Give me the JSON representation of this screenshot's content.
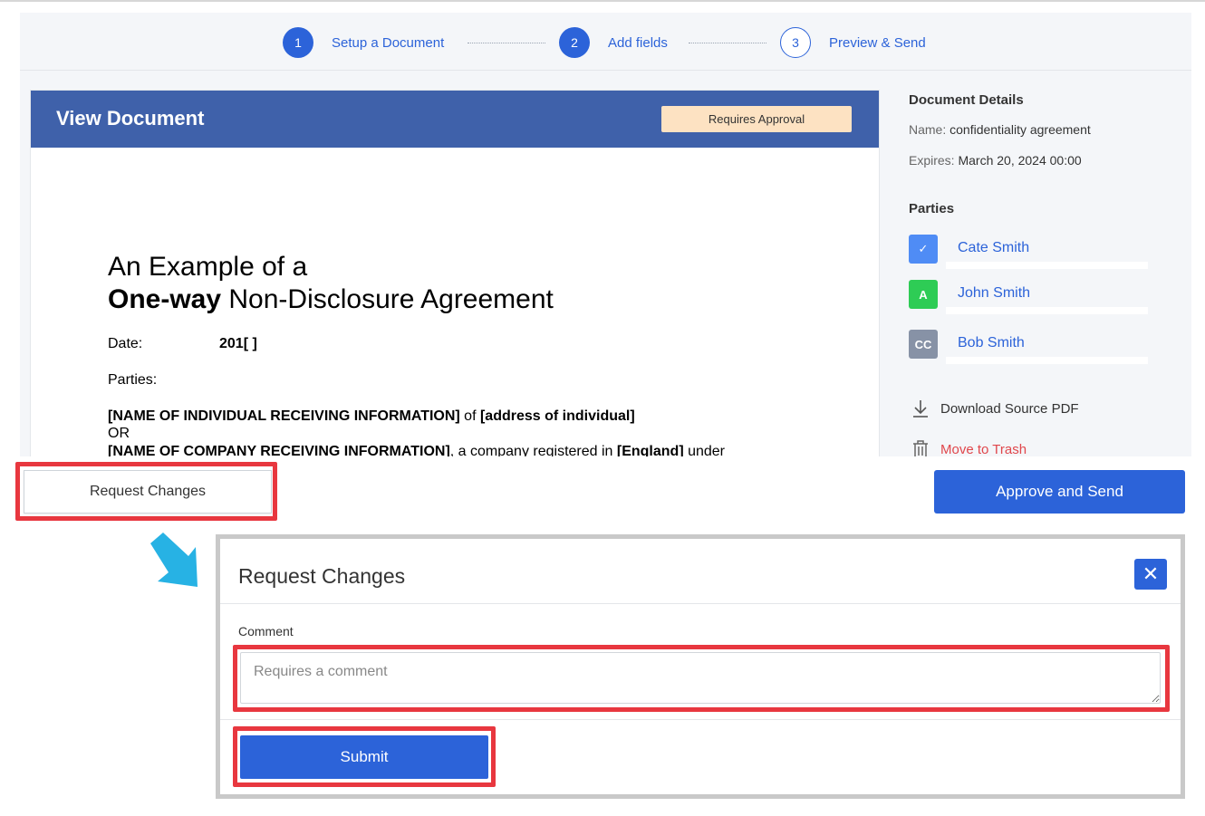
{
  "stepper": {
    "steps": [
      {
        "num": "1",
        "label": "Setup a Document"
      },
      {
        "num": "2",
        "label": "Add fields"
      },
      {
        "num": "3",
        "label": "Preview & Send"
      }
    ]
  },
  "viewer": {
    "title": "View Document",
    "badge": "Requires Approval"
  },
  "document": {
    "title_line1": "An Example of a",
    "title_line2_bold": "One-way",
    "title_line2_rest": " Non-Disclosure Agreement",
    "date_label": "Date:",
    "date_value": "201[ ]",
    "parties_label": "Parties:",
    "para1_bold": "[NAME OF INDIVIDUAL RECEIVING INFORMATION]",
    "para1_mid": " of ",
    "para1_bold2": "[address of individual]",
    "or": "OR",
    "para2_bold": "[NAME OF COMPANY RECEIVING INFORMATION]",
    "para2_mid": ", a company registered in ",
    "para2_bold2": "[England]",
    "para2_end": " under"
  },
  "sidebar": {
    "details_heading": "Document Details",
    "name_key": "Name:",
    "name_value": "confidentiality agreement",
    "expires_key": "Expires:",
    "expires_value": "March 20, 2024 00:00",
    "parties_heading": "Parties",
    "parties": [
      {
        "avatar": "✓",
        "name": "Cate Smith",
        "color": "#4f8cf5"
      },
      {
        "avatar": "A",
        "name": "John Smith",
        "color": "#2ecc55"
      },
      {
        "avatar": "CC",
        "name": "Bob Smith",
        "color": "#8792a6"
      }
    ],
    "download_label": "Download Source PDF",
    "trash_label": "Move to Trash"
  },
  "actions": {
    "request_changes": "Request Changes",
    "approve_send": "Approve and Send"
  },
  "modal": {
    "title": "Request Changes",
    "close": "✕",
    "comment_label": "Comment",
    "comment_placeholder": "Requires a comment",
    "comment_value": "",
    "submit": "Submit"
  },
  "colors": {
    "primary": "#2c63d9",
    "header": "#3f61aa",
    "highlight": "#e8373f",
    "arrow": "#27b2e4",
    "trash": "#e0474c"
  }
}
